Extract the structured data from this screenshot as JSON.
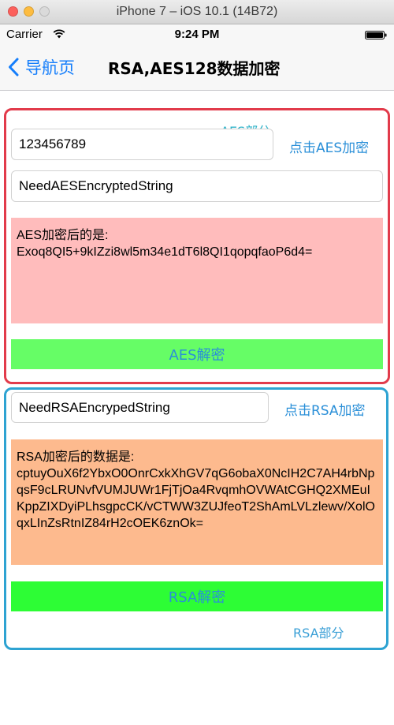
{
  "window": {
    "title": "iPhone 7 – iOS 10.1 (14B72)"
  },
  "status_bar": {
    "carrier": "Carrier",
    "time": "9:24 PM"
  },
  "nav": {
    "back_label": "导航页",
    "title": "RSA,AES128数据加密"
  },
  "aes": {
    "section_label": "AES部分",
    "key_value": "123456789",
    "plain_value": "NeedAESEncryptedString",
    "encrypt_button": "点击AES加密",
    "result_prefix": "AES加密后的是:",
    "result_value": "Exoq8QI5+9kIZzi8wl5m34e1dT6l8QI1qopqfaoP6d4=",
    "decrypt_button": "AES解密"
  },
  "rsa": {
    "section_label": "RSA部分",
    "plain_value": "NeedRSAEncrypedString",
    "encrypt_button": "点击RSA加密",
    "result_prefix": "RSA加密后的数据是:",
    "result_value": "cptuyOuX6f2YbxO0OnrCxkXhGV7qG6obaX0NcIH2C7AH4rbNpqsF9cLRUNvfVUMJUWr1FjTjOa4RvqmhOVWAtCGHQ2XMEuIKppZIXDyiPLhsgpcCK/vCTWW3ZUJfeoT2ShAmLVLzlewv/XolOqxLInZsRtnIZ84rH2cOEK6znOk=",
    "decrypt_button": "RSA解密"
  },
  "colors": {
    "ios_blue": "#157efb",
    "aes_border": "#e23b4b",
    "rsa_border": "#2ea3d2",
    "aes_result_bg": "#ffbcbc",
    "rsa_result_bg": "#fdba8e",
    "aes_button_bg": "#66fd66",
    "rsa_button_bg": "#2dfd35"
  },
  "icons": [
    "wifi-icon",
    "battery-icon",
    "back-chevron-icon"
  ]
}
